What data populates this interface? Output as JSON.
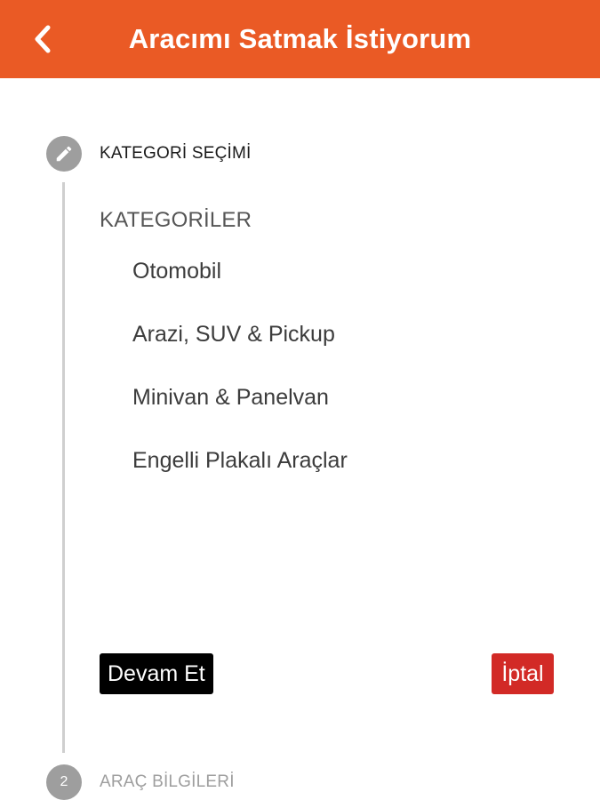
{
  "header": {
    "title": "Aracımı Satmak İstiyorum",
    "back_icon": "chevron-left-icon",
    "background_color": "#ea5a25"
  },
  "stepper": {
    "steps": [
      {
        "icon": "pencil-icon",
        "title": "KATEGORİ SEÇİMİ",
        "state": "active"
      },
      {
        "number": "2",
        "title": "ARAÇ BİLGİLERİ",
        "state": "inactive"
      }
    ]
  },
  "categories": {
    "heading": "KATEGORİLER",
    "items": [
      "Otomobil",
      "Arazi, SUV & Pickup",
      "Minivan & Panelvan",
      "Engelli Plakalı Araçlar"
    ]
  },
  "actions": {
    "continue_label": "Devam Et",
    "cancel_label": "İptal",
    "cancel_color": "#d22a26"
  }
}
